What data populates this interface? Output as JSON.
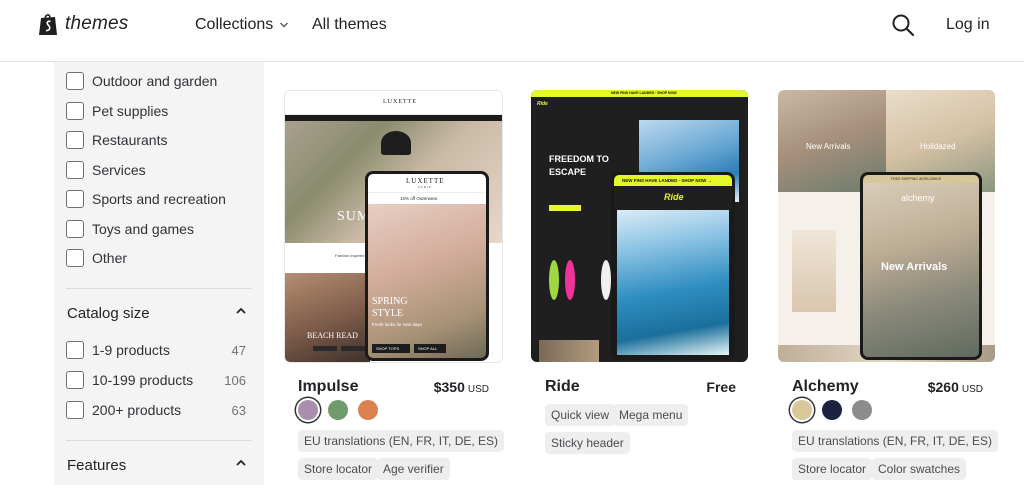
{
  "header": {
    "logo_text": "themes",
    "nav": {
      "collections": "Collections",
      "all_themes": "All themes"
    },
    "login": "Log in"
  },
  "sidebar": {
    "industry_items": [
      "Outdoor and garden",
      "Pet supplies",
      "Restaurants",
      "Services",
      "Sports and recreation",
      "Toys and games",
      "Other"
    ],
    "catalog_size": {
      "title": "Catalog size",
      "items": [
        {
          "label": "1-9 products",
          "count": "47"
        },
        {
          "label": "10-199 products",
          "count": "106"
        },
        {
          "label": "200+ products",
          "count": "63"
        }
      ]
    },
    "features": {
      "title": "Features"
    }
  },
  "themes": [
    {
      "name": "Impulse",
      "price": "$350",
      "currency": "USD",
      "swatches": [
        "#a98fae",
        "#6f9a6b",
        "#d9824f"
      ],
      "tags": [
        "EU translations (EN, FR, IT, DE, ES)",
        "Store locator",
        "Age verifier"
      ],
      "preview": {
        "brand": "LUXETTE",
        "brand_sub": "PARIS",
        "announcement": "15% off Outerwear",
        "hero_word": "SUM",
        "hero_sub": "Fashion inspired",
        "mobile_title_1": "SPRING",
        "mobile_title_2": "STYLE",
        "mobile_sub": "Fresh looks for new days",
        "btn1": "SHOP TOPS",
        "btn2": "SHOP ALL",
        "beach": "BEACH READ"
      }
    },
    {
      "name": "Ride",
      "price": "Free",
      "currency": "",
      "swatches": [],
      "tags": [
        "Quick view",
        "Mega menu",
        "Sticky header"
      ],
      "preview": {
        "top_banner": "NEW FINS HAVE LANDED · SHOP NOW",
        "hero_1": "FREEDOM TO",
        "hero_2": "ESCAPE",
        "mobile_banner": "NEW FINS HAVE LANDED · SHOP NOW →",
        "logo": "Ride"
      }
    },
    {
      "name": "Alchemy",
      "price": "$260",
      "currency": "USD",
      "swatches": [
        "#d8c79a",
        "#1b2340",
        "#8c8c8c"
      ],
      "tags": [
        "EU translations (EN, FR, IT, DE, ES)",
        "Store locator",
        "Color swatches"
      ],
      "preview": {
        "logo": "alchemy",
        "new_arrivals": "New Arrivals",
        "holidazed": "Holidazed",
        "mobile_new": "New Arrivals",
        "banner": "FREE SHIPPING WORLDWIDE"
      }
    }
  ]
}
